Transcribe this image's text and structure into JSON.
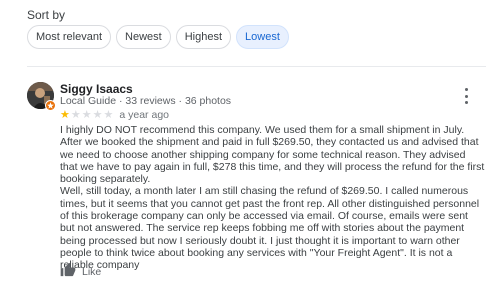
{
  "sort": {
    "label": "Sort by",
    "options": [
      "Most relevant",
      "Newest",
      "Highest",
      "Lowest"
    ],
    "selected": "Lowest"
  },
  "review": {
    "reviewer_name": "Siggy Isaacs",
    "reviewer_level": "Local Guide",
    "reviews_count": "33 reviews",
    "photos_count": "36 photos",
    "separator": " · ",
    "rating": 1,
    "rating_max": 5,
    "time": "a year ago",
    "paragraphs": [
      "I highly DO NOT recommend this company. We used them for a small shipment in July. After we booked the shipment and paid in full $269.50, they contacted us and advised that we need to choose another shipping company for some technical reason. They advised that we have to pay again in full, $278 this time, and they will process the refund for the first booking separately.",
      "Well, still today, a month later I am still chasing the refund of $269.50. I called numerous times, but it seems that you cannot get past the front rep. All other distinguished personnel of this brokerage company can only be accessed via email. Of course, emails were sent but not answered. The service rep keeps fobbing me off with stories about the payment being processed but now I seriously doubt it.   I just thought it is important to warn other people to think twice about booking any services with \"Your Freight Agent\". It is not a reliable company"
    ],
    "like_label": "Like"
  },
  "colors": {
    "star": "#fbbc04",
    "selected_chip_bg": "#e8f0fe",
    "selected_chip_text": "#1967d2",
    "guide_badge": "#e8710a"
  },
  "icons": {
    "more": "more-vert-icon",
    "like": "thumb-up-icon",
    "badge": "local-guide-badge-icon"
  }
}
